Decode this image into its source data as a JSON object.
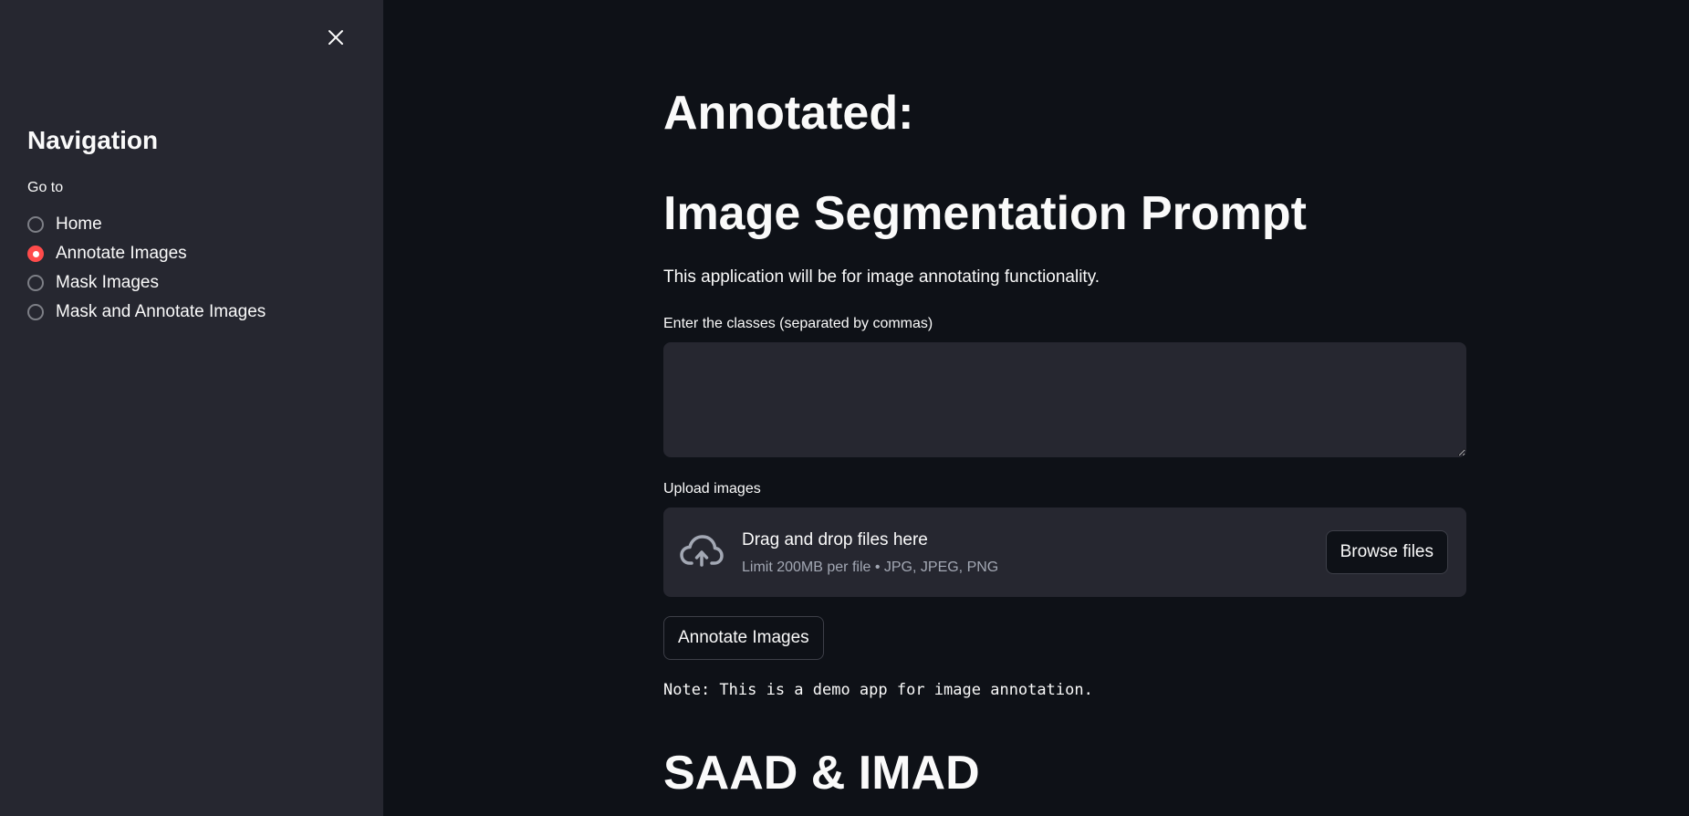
{
  "sidebar": {
    "close_icon": "close-icon",
    "title": "Navigation",
    "radio_label": "Go to",
    "options": [
      {
        "label": "Home",
        "checked": false
      },
      {
        "label": "Annotate Images",
        "checked": true
      },
      {
        "label": "Mask Images",
        "checked": false
      },
      {
        "label": "Mask and Annotate Images",
        "checked": false
      }
    ]
  },
  "main": {
    "heading_annotated": "Annotated:",
    "heading_title": "Image Segmentation Prompt",
    "description": "This application will be for image annotating functionality.",
    "classes_label": "Enter the classes (separated by commas)",
    "classes_value": "",
    "upload_label": "Upload images",
    "uploader": {
      "icon": "cloud-upload-icon",
      "title": "Drag and drop files here",
      "limit": "Limit 200MB per file • JPG, JPEG, PNG",
      "browse_label": "Browse files"
    },
    "annotate_button": "Annotate Images",
    "note": "Note: This is a demo app for image annotation.",
    "footer_heading": "SAAD & IMAD"
  },
  "colors": {
    "background": "#0e1117",
    "sidebar": "#262730",
    "accent": "#ff4b4b",
    "text": "#fafafa"
  }
}
